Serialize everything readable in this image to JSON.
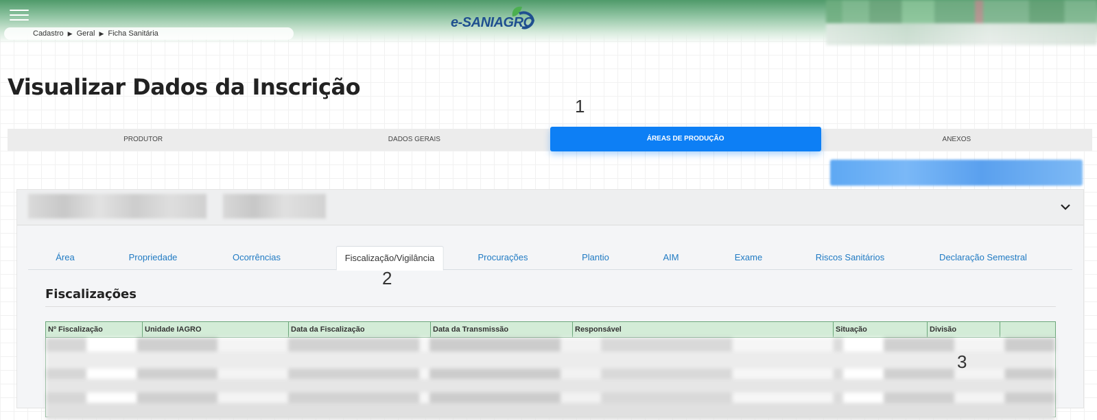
{
  "header": {
    "logo_text": "e-SANIAGRO",
    "breadcrumb": [
      "Cadastro",
      "Geral",
      "Ficha Sanitária"
    ],
    "colors": {
      "header_green": "#4f9a6a",
      "logo_blue": "#1f4f8f",
      "leaf_green": "#4caf50"
    }
  },
  "page_title": "Visualizar Dados da Inscrição",
  "annotations": [
    "1",
    "2",
    "3"
  ],
  "main_tabs": [
    {
      "label": "PRODUTOR",
      "active": false
    },
    {
      "label": "DADOS GERAIS",
      "active": false
    },
    {
      "label": "ÁREAS DE PRODUÇÃO",
      "active": true
    },
    {
      "label": "ANEXOS",
      "active": false
    }
  ],
  "sub_tabs": [
    {
      "label": "Área",
      "active": false
    },
    {
      "label": "Propriedade",
      "active": false
    },
    {
      "label": "Ocorrências",
      "active": false
    },
    {
      "label": "Fiscalização/Vigilância",
      "active": true
    },
    {
      "label": "Procurações",
      "active": false
    },
    {
      "label": "Plantio",
      "active": false
    },
    {
      "label": "AIM",
      "active": false
    },
    {
      "label": "Exame",
      "active": false
    },
    {
      "label": "Riscos Sanitários",
      "active": false
    },
    {
      "label": "Declaração Semestral",
      "active": false
    }
  ],
  "section": {
    "title": "Fiscalizações",
    "table_headers": [
      "Nº Fiscalização",
      "Unidade IAGRO",
      "Data da Fiscalização",
      "Data da Transmissão",
      "Responsável",
      "Situação",
      "Divisão",
      ""
    ]
  },
  "colors": {
    "accent_blue": "#0d7ff5",
    "link_blue": "#1f7ac3",
    "table_header_bg": "#d3ecd7"
  }
}
